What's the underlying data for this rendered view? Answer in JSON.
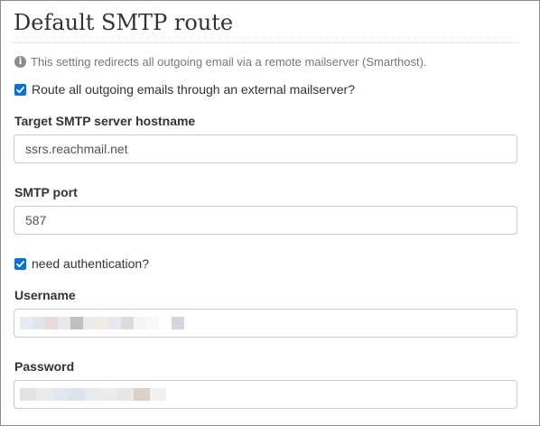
{
  "section": {
    "title": "Default SMTP route",
    "info_text": "This setting redirects all outgoing email via a remote mailserver (Smarthost)."
  },
  "route_checkbox": {
    "label": "Route all outgoing emails through an external mailserver?",
    "checked": true
  },
  "hostname": {
    "label": "Target SMTP server hostname",
    "value": "ssrs.reachmail.net"
  },
  "port": {
    "label": "SMTP port",
    "value": "587"
  },
  "auth_checkbox": {
    "label": "need authentication?",
    "checked": true
  },
  "username": {
    "label": "Username",
    "redacted": true,
    "blur_colors": [
      "#e6ecf1",
      "#dfe5ea",
      "#e9d9d9",
      "#e6eaee",
      "#bfbfbf",
      "#e8eaec",
      "#f3ece0",
      "#e6eaf0",
      "#dcdcdc",
      "#f2f5f7",
      "#f7f9fa",
      "#ffffff",
      "#d3d6e0"
    ]
  },
  "password": {
    "label": "Password",
    "redacted": true,
    "blur_colors": [
      "#e3e3e3",
      "#e9ecef",
      "#e0e8ef",
      "#dbe4ea",
      "#e6ebf0",
      "#ececec",
      "#e7e7e7",
      "#ddd0c7",
      "#f1f1f1"
    ]
  },
  "colors": {
    "checkbox": "#0a6fd9",
    "border": "#cccccc",
    "text": "#333333",
    "muted": "#777777"
  }
}
